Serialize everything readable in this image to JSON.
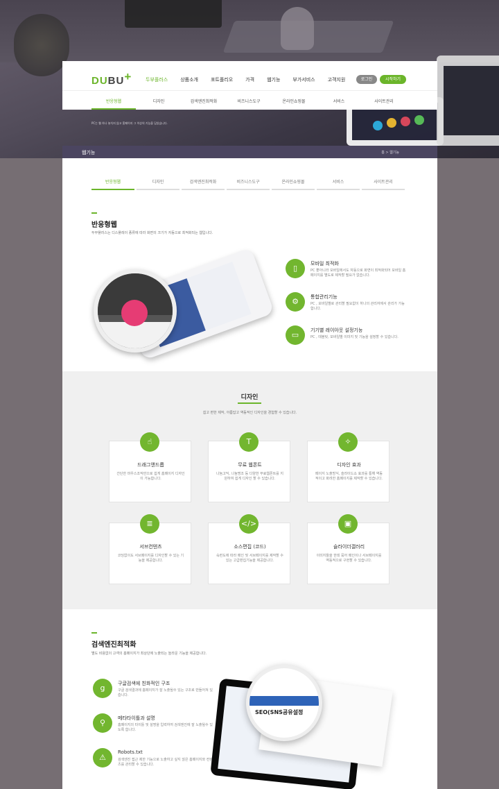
{
  "brand": {
    "du": "DU",
    "bu": "BU",
    "plus": "+",
    "accent": "#6bb52a"
  },
  "nav": {
    "items": [
      "두부플러스",
      "상품소개",
      "포트폴리오",
      "가격",
      "웹기능",
      "부가서비스",
      "고객지원"
    ],
    "login": "로그인",
    "start": "시작하기"
  },
  "subnav": [
    "반응형웹",
    "디자인",
    "검색엔진최적화",
    "비즈니스도구",
    "온라인쇼핑몰",
    "서비스",
    "사이트관리"
  ],
  "hero_caption": "PC는 웹 하나 놓치지 않고 홈페이지 그 이상의 기능을 담았습니다.",
  "crumbbar": {
    "title": "웹기능",
    "crumb": "홈 > 웹기능"
  },
  "tabs": [
    "반응형웹",
    "디자인",
    "검색엔진최적화",
    "비즈니스도구",
    "온라인쇼핑몰",
    "서비스",
    "사이트관리"
  ],
  "responsive": {
    "title": "반응형웹",
    "desc": "두부플러스는 디스플레이 종류에 따라 화면의 크기가 자동으로 최적화되는 웹입니다.",
    "features": [
      {
        "icon": "mobile-icon",
        "title": "모바일 최적화",
        "desc": "PC 뿐아니라 모바일에서도 자동으로 화면이 최적화되어 모바일 홈페이지를 별도로 제작할 필요가 없습니다."
      },
      {
        "icon": "gear-icon",
        "title": "통합관리기능",
        "desc": "PC , 모바일별로 관리할 필요없이 하나의 관리자에서 관리가 가능합니다."
      },
      {
        "icon": "device-icon",
        "title": "기기별 레이아웃 설정기능",
        "desc": "PC , 태블릿, 모바일별 이미지 및 기능을 설정할 수 있습니다."
      }
    ]
  },
  "design": {
    "title": "디자인",
    "desc": "쉽고 편한 제작, 아름답고 역동적인 디자인을 경험할 수 있습니다.",
    "cards": [
      {
        "icon": "drag-icon",
        "title": "드래그앤드롭",
        "desc": "간단한 마우스조작만으로 쉽게 홈페이지 디자인이 가능합니다."
      },
      {
        "icon": "font-icon",
        "title": "무료 웹폰트",
        "desc": "나눔고딕, 나눔명조 등 다양한 무료웹폰트를 지원하여 쉽게 디자인 할 수 있습니다."
      },
      {
        "icon": "magic-icon",
        "title": "디자인 효과",
        "desc": "페이지 노출방식, 슬라이드쇼 효과를 통해 역동적이고 화려한 홈페이지를 제작할 수 있습니다."
      },
      {
        "icon": "document-icon",
        "title": "서브컨텐츠",
        "desc": "코딩없이도 서브페이지를 디자인할 수 있는 기능을 제공합니다."
      },
      {
        "icon": "code-icon",
        "title": "소스편집 (코드)",
        "desc": "숙련도에 따라 메인 및 서브페이지를 제작할 수 있는 고급편집기능을 제공합니다."
      },
      {
        "icon": "gallery-icon",
        "title": "슬라이더갤러리",
        "desc": "이미지들을 한데 묶어 메인이나 서브페이지를 역동적으로 구현할 수 있습니다."
      }
    ]
  },
  "seo": {
    "title": "검색엔진최적화",
    "desc": "별도 비용없이 고객의 홈페이지가 최상단에 노출되는 놀라운 기능을 제공합니다.",
    "features": [
      {
        "icon": "google-icon",
        "glyph": "g",
        "title": "구글검색에 친화적인 구조",
        "desc": "구글 검색결과에 홈페이지가 잘 노출될수 있는 구조로 만들어져 있습니다."
      },
      {
        "icon": "magnifier-icon",
        "glyph": "⚲",
        "title": "메타타이틀과 설명",
        "desc": "홈페이지의 타이틀 및 설명을 입력하여 검색엔진에 잘 노출될수 있도록 합니다."
      },
      {
        "icon": "warning-icon",
        "glyph": "⚠",
        "title": "Robots.txt",
        "desc": "검색엔진 접근 제한 기능으로 노출하고 싶지 않은 홈페이지와 컨텐츠를 관리할 수 있습니다."
      }
    ],
    "lens_text": "SEO(SNS공유설정"
  }
}
